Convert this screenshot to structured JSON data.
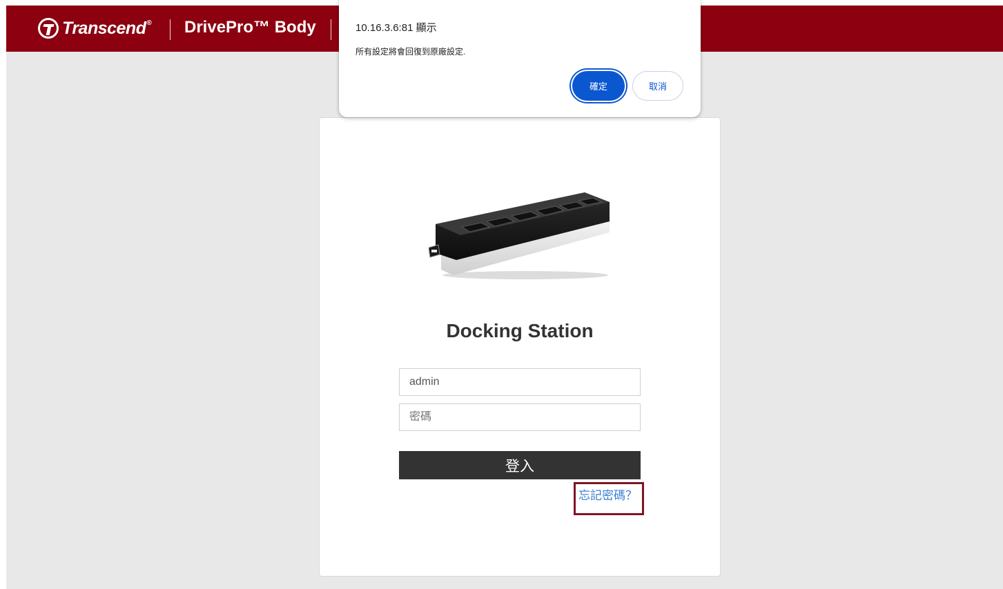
{
  "header": {
    "brand": "Transcend",
    "brand_mark": "®",
    "product": "DrivePro™ Body"
  },
  "login": {
    "title": "Docking Station",
    "username_value": "admin",
    "password_placeholder": "密碼",
    "login_label": "登入",
    "forgot_label": "忘記密碼？"
  },
  "dialog": {
    "origin": "10.16.3.6:81 顯示",
    "message": "所有設定將會回復到原廠設定.",
    "ok_label": "確定",
    "cancel_label": "取消"
  },
  "colors": {
    "header_bg": "#8c0010",
    "page_bg": "#e8e8e8",
    "login_button": "#333333",
    "dialog_accent": "#0b57d0",
    "link": "#3a7fd0",
    "highlight_box": "#7d1424"
  },
  "icons": {
    "brand": "transcend-logo-icon",
    "device": "docking-station-image"
  }
}
